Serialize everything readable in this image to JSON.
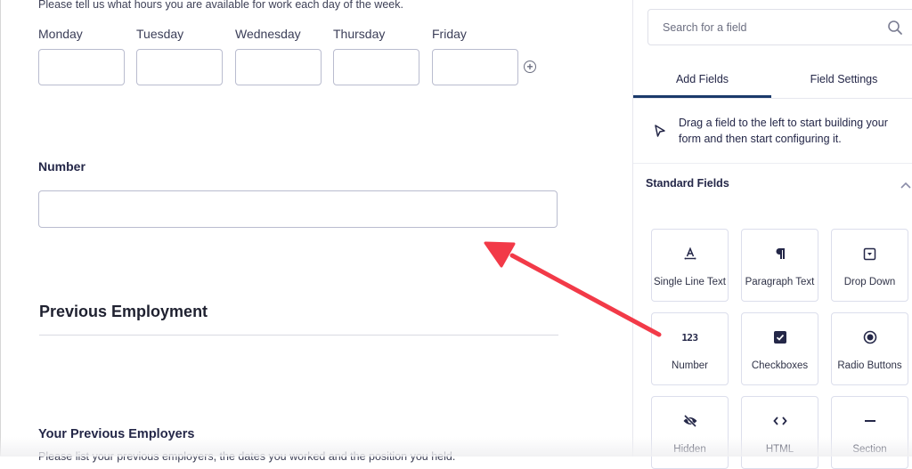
{
  "canvas": {
    "hours_description": "Please tell us what hours you are available for work each day of the week.",
    "days": [
      {
        "label": "Monday",
        "value": ""
      },
      {
        "label": "Tuesday",
        "value": ""
      },
      {
        "label": "Wednesday",
        "value": ""
      },
      {
        "label": "Thursday",
        "value": ""
      },
      {
        "label": "Friday",
        "value": ""
      }
    ],
    "add_day_icon": "plus-circle-icon",
    "number_field": {
      "label": "Number",
      "value": ""
    },
    "section": {
      "title": "Previous Employment"
    },
    "employers": {
      "title": "Your Previous Employers",
      "description": "Please list your previous employers, the dates you worked and the position you held."
    }
  },
  "sidebar": {
    "search": {
      "placeholder": "Search for a field",
      "value": "",
      "icon": "search-icon"
    },
    "tabs": [
      {
        "label": "Add Fields",
        "active": true
      },
      {
        "label": "Field Settings",
        "active": false
      }
    ],
    "hint": "Drag a field to the left to start building your form and then start configuring it.",
    "group": {
      "title": "Standard Fields",
      "expanded": true,
      "fields": [
        {
          "label": "Single Line Text",
          "icon": "text-a-icon"
        },
        {
          "label": "Paragraph Text",
          "icon": "pilcrow-icon"
        },
        {
          "label": "Drop Down",
          "icon": "dropdown-icon"
        },
        {
          "label": "Number",
          "icon": "number-123-icon",
          "glyph": "123"
        },
        {
          "label": "Checkboxes",
          "icon": "checkbox-icon"
        },
        {
          "label": "Radio Buttons",
          "icon": "radio-icon"
        },
        {
          "label": "Hidden",
          "icon": "eye-slash-icon"
        },
        {
          "label": "HTML",
          "icon": "code-icon",
          "glyph": "<>"
        },
        {
          "label": "Section",
          "icon": "section-dash-icon"
        }
      ]
    }
  },
  "annotation": {
    "type": "arrow",
    "color": "#f23a48",
    "points_to": "number-field-input",
    "from": "field-tile-number"
  }
}
